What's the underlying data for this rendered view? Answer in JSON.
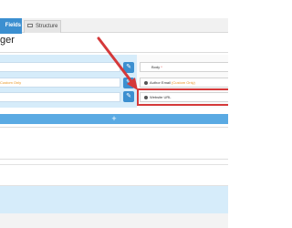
{
  "tabs": [
    {
      "label": "Fields",
      "icon": "fields-tab",
      "active": true
    },
    {
      "label": "Structure",
      "icon": "grid-icon",
      "active": false
    }
  ],
  "header": {
    "title": "ger"
  },
  "left_rows": [
    {
      "text": "",
      "button_icon": "pencil-icon"
    },
    {
      "text": "Custom Only",
      "button_icon": "pencil-icon"
    },
    {
      "text": "",
      "button_icon": "pencil-icon"
    }
  ],
  "fields": [
    {
      "label": "Body",
      "marker": "*",
      "marker_color": "#e05050"
    },
    {
      "label": "Author Email",
      "marker": "(Custom Only)",
      "marker_color": "#e8931e"
    },
    {
      "label": "Website URL",
      "marker": "",
      "marker_color": ""
    }
  ],
  "add_bar": {
    "label": "+"
  },
  "colors": {
    "accent": "#3b8fd0",
    "panel": "#d6ecfa",
    "highlight": "#d5393a"
  }
}
